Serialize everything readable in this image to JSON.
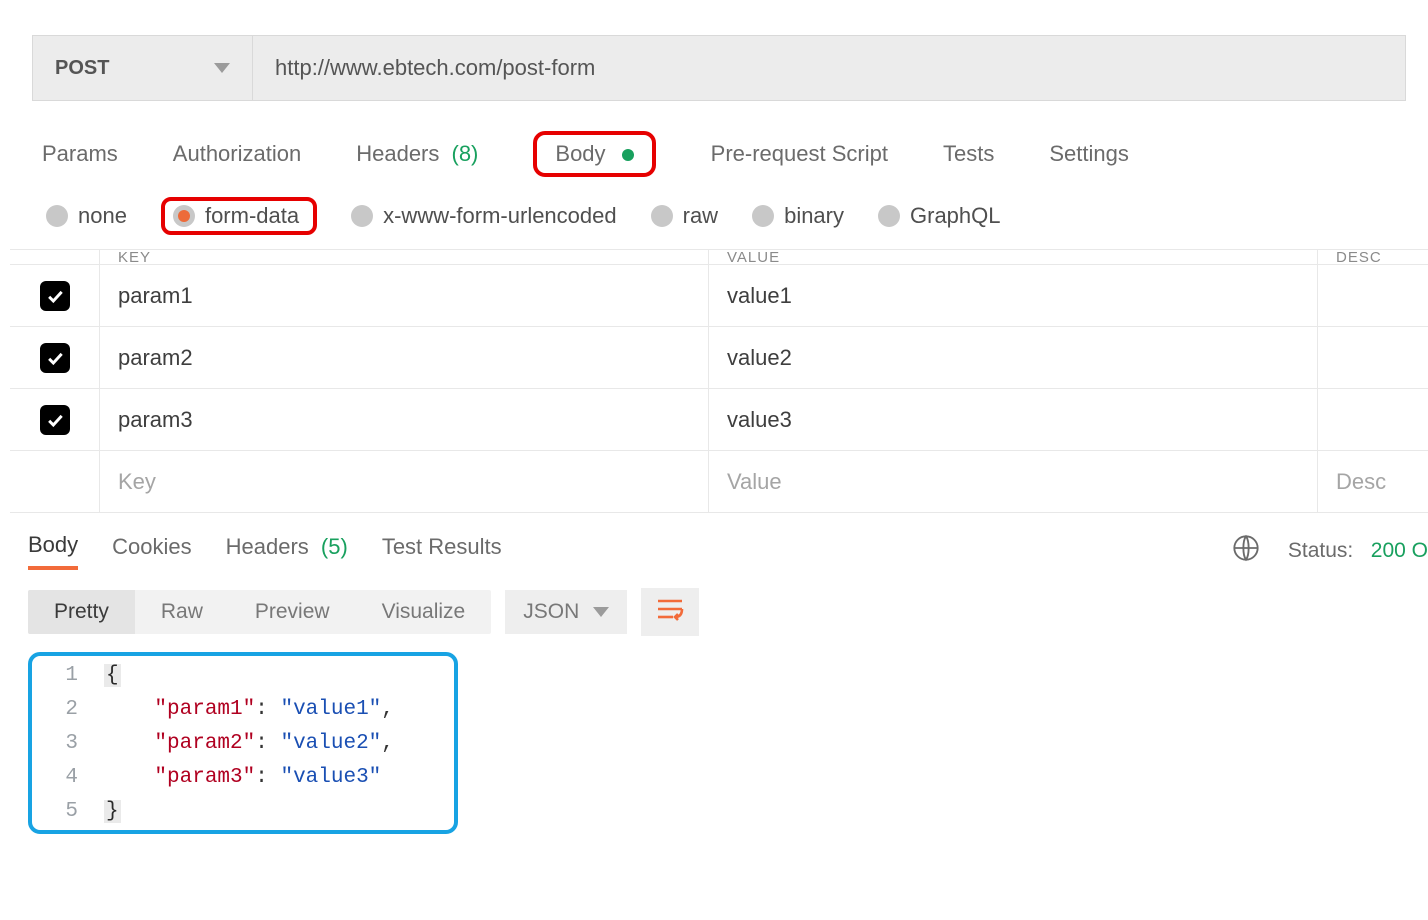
{
  "request": {
    "method": "POST",
    "url": "http://www.ebtech.com/post-form"
  },
  "requestTabs": {
    "params": "Params",
    "authorization": "Authorization",
    "headers": "Headers",
    "headersCount": "(8)",
    "body": "Body",
    "prerequest": "Pre-request Script",
    "tests": "Tests",
    "settings": "Settings"
  },
  "bodyTypes": {
    "none": "none",
    "formData": "form-data",
    "urlencoded": "x-www-form-urlencoded",
    "raw": "raw",
    "binary": "binary",
    "graphql": "GraphQL"
  },
  "paramsTable": {
    "headers": {
      "key": "KEY",
      "value": "VALUE",
      "desc": "DESC"
    },
    "rows": [
      {
        "key": "param1",
        "value": "value1"
      },
      {
        "key": "param2",
        "value": "value2"
      },
      {
        "key": "param3",
        "value": "value3"
      }
    ],
    "placeholders": {
      "key": "Key",
      "value": "Value",
      "desc": "Desc"
    }
  },
  "responseTabs": {
    "body": "Body",
    "cookies": "Cookies",
    "headers": "Headers",
    "headersCount": "(5)",
    "testResults": "Test Results"
  },
  "responseStatus": {
    "label": "Status:",
    "code": "200 O"
  },
  "responseViews": {
    "pretty": "Pretty",
    "raw": "Raw",
    "preview": "Preview",
    "visualize": "Visualize",
    "format": "JSON"
  },
  "responseBody": {
    "lines": [
      {
        "n": "1",
        "type": "brace",
        "text": "{"
      },
      {
        "n": "2",
        "type": "kv",
        "key": "\"param1\"",
        "value": "\"value1\"",
        "comma": ","
      },
      {
        "n": "3",
        "type": "kv",
        "key": "\"param2\"",
        "value": "\"value2\"",
        "comma": ","
      },
      {
        "n": "4",
        "type": "kv",
        "key": "\"param3\"",
        "value": "\"value3\"",
        "comma": ""
      },
      {
        "n": "5",
        "type": "brace",
        "text": "}"
      }
    ]
  }
}
